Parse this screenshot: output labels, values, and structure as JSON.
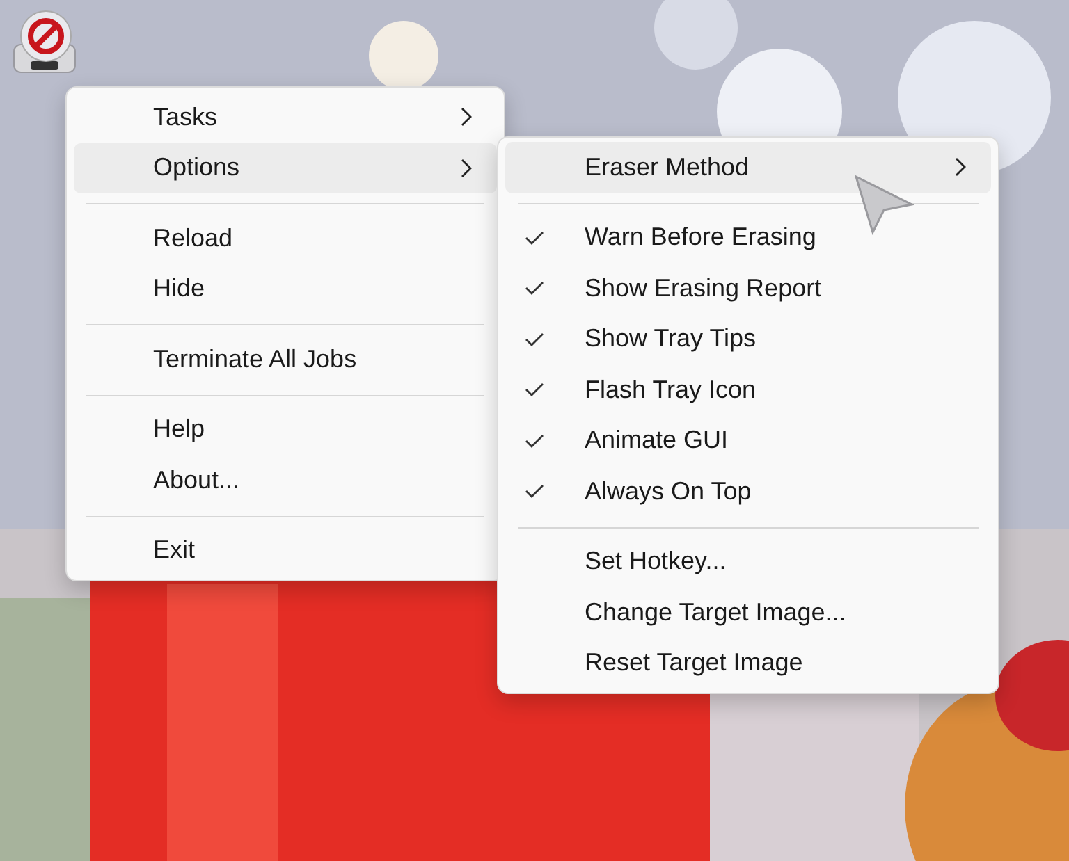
{
  "menus": [
    {
      "items": [
        {
          "kind": "item",
          "label": "Tasks",
          "has_submenu": true,
          "selected": false
        },
        {
          "kind": "item",
          "label": "Options",
          "has_submenu": true,
          "selected": true
        },
        {
          "kind": "separator"
        },
        {
          "kind": "item",
          "label": "Reload",
          "has_submenu": false,
          "selected": false
        },
        {
          "kind": "item",
          "label": "Hide",
          "has_submenu": false,
          "selected": false
        },
        {
          "kind": "separator"
        },
        {
          "kind": "item",
          "label": "Terminate All Jobs",
          "has_submenu": false,
          "selected": false
        },
        {
          "kind": "separator"
        },
        {
          "kind": "item",
          "label": "Help",
          "has_submenu": false,
          "selected": false
        },
        {
          "kind": "item",
          "label": "About...",
          "has_submenu": false,
          "selected": false
        },
        {
          "kind": "separator"
        },
        {
          "kind": "item",
          "label": "Exit",
          "has_submenu": false,
          "selected": false
        }
      ]
    },
    {
      "items": [
        {
          "kind": "item",
          "label": "Eraser Method",
          "has_submenu": true,
          "selected": true,
          "checked": false
        },
        {
          "kind": "separator"
        },
        {
          "kind": "item",
          "label": "Warn Before Erasing",
          "has_submenu": false,
          "selected": false,
          "checked": true
        },
        {
          "kind": "item",
          "label": "Show Erasing Report",
          "has_submenu": false,
          "selected": false,
          "checked": true
        },
        {
          "kind": "item",
          "label": "Show Tray Tips",
          "has_submenu": false,
          "selected": false,
          "checked": true
        },
        {
          "kind": "item",
          "label": "Flash Tray Icon",
          "has_submenu": false,
          "selected": false,
          "checked": true
        },
        {
          "kind": "item",
          "label": "Animate GUI",
          "has_submenu": false,
          "selected": false,
          "checked": true
        },
        {
          "kind": "item",
          "label": "Always On Top",
          "has_submenu": false,
          "selected": false,
          "checked": true
        },
        {
          "kind": "separator"
        },
        {
          "kind": "item",
          "label": "Set Hotkey...",
          "has_submenu": false,
          "selected": false,
          "checked": false
        },
        {
          "kind": "item",
          "label": "Change Target Image...",
          "has_submenu": false,
          "selected": false,
          "checked": false
        },
        {
          "kind": "item",
          "label": "Reset Target Image",
          "has_submenu": false,
          "selected": false,
          "checked": false
        }
      ]
    }
  ]
}
